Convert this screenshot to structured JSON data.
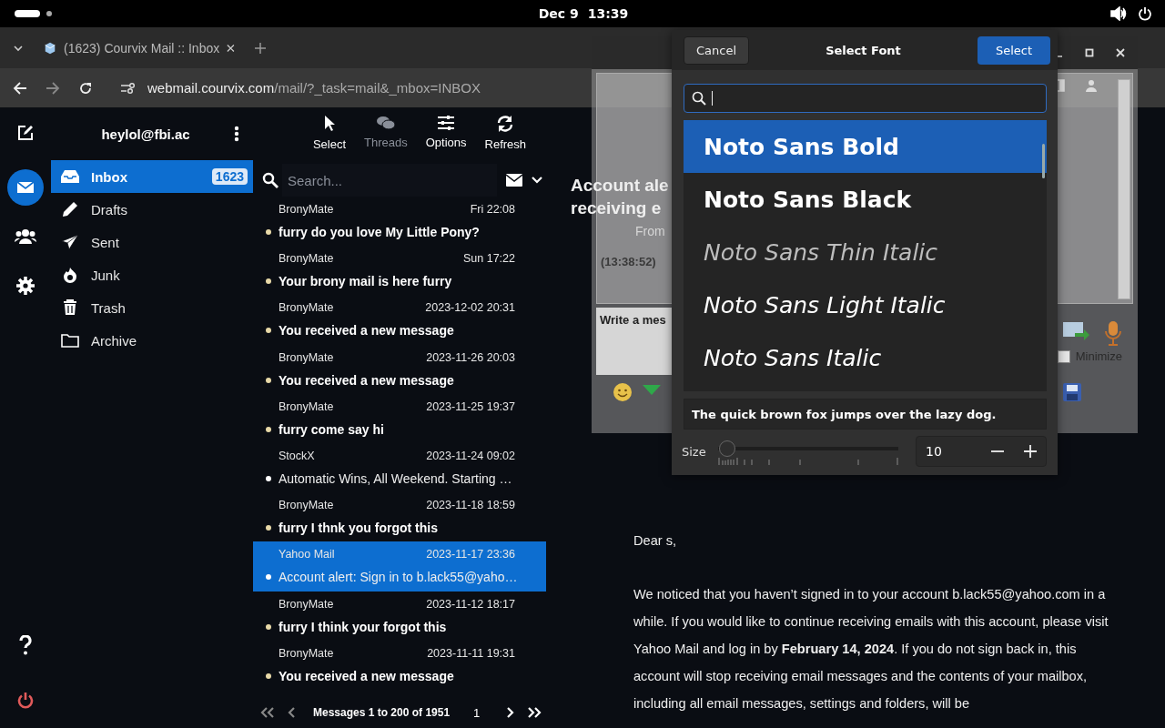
{
  "system_bar": {
    "date": "Dec 9",
    "time": "13:39"
  },
  "browser": {
    "tab_title": "(1623) Courvix Mail :: Inbox",
    "url_host": "webmail.courvix.com",
    "url_path": "/mail/?_task=mail&_mbox=INBOX"
  },
  "rail": [
    {
      "selected": true
    },
    {
      "selected": false
    },
    {
      "selected": false
    }
  ],
  "account": "heylol@fbi.ac",
  "folders": [
    {
      "name": "Inbox",
      "count": "1623",
      "selected": true
    },
    {
      "name": "Drafts",
      "selected": false
    },
    {
      "name": "Sent",
      "selected": false
    },
    {
      "name": "Junk",
      "selected": false
    },
    {
      "name": "Trash",
      "selected": false
    },
    {
      "name": "Archive",
      "selected": false
    }
  ],
  "toolbar": [
    {
      "label": "Select",
      "disabled": false
    },
    {
      "label": "Threads",
      "disabled": true
    },
    {
      "label": "Options",
      "disabled": false
    },
    {
      "label": "Refresh",
      "disabled": false
    }
  ],
  "search": {
    "placeholder": "Search..."
  },
  "messages": [
    {
      "from": "BronyMate",
      "date": "Fri 22:08",
      "subject": "furry do you love My Little Pony?",
      "unread": true,
      "selected": false
    },
    {
      "from": "BronyMate",
      "date": "Sun 17:22",
      "subject": "Your brony mail is here furry",
      "unread": true,
      "selected": false
    },
    {
      "from": "BronyMate",
      "date": "2023-12-02 20:31",
      "subject": "You received a new message",
      "unread": true,
      "selected": false
    },
    {
      "from": "BronyMate",
      "date": "2023-11-26 20:03",
      "subject": "You received a new message",
      "unread": true,
      "selected": false
    },
    {
      "from": "BronyMate",
      "date": "2023-11-25 19:37",
      "subject": "furry come say hi",
      "unread": true,
      "selected": false
    },
    {
      "from": "StockX",
      "date": "2023-11-24 09:02",
      "subject": "Automatic Wins, All Weekend. Starting …",
      "unread": false,
      "selected": false
    },
    {
      "from": "BronyMate",
      "date": "2023-11-18 18:59",
      "subject": "furry I thnk you forgot this",
      "unread": true,
      "selected": false
    },
    {
      "from": "Yahoo Mail",
      "date": "2023-11-17 23:36",
      "subject": "Account alert: Sign in to b.lack55@yaho…",
      "unread": false,
      "selected": true
    },
    {
      "from": "BronyMate",
      "date": "2023-11-12 18:17",
      "subject": "furry I think your forgot this",
      "unread": true,
      "selected": false
    },
    {
      "from": "BronyMate",
      "date": "2023-11-11 19:31",
      "subject": "You received a new message",
      "unread": true,
      "selected": false
    }
  ],
  "pager": {
    "summary": "Messages 1 to 200 of 1951",
    "page": "1"
  },
  "message": {
    "heading_lines": [
      "Account ale",
      "receiving e"
    ],
    "greeting": "Dear s,",
    "body": "We noticed that you haven’t signed in to your account b.lack55@yahoo.com in a while. If you would like to continue receiving emails with this account, please visit Yahoo Mail and log in by **February 14, 2024**. If you do not sign back in, this account will stop receiving email messages and the contents of your mailbox, including all email messages, settings and folders, will be"
  },
  "chat_window": {
    "from_label": "From",
    "timestamp": "(13:38:52)",
    "input_text": "Write a mes",
    "minimize": {
      "label": "Minimize",
      "checked": false
    }
  },
  "font_dialog": {
    "title": "Select Font",
    "cancel": "Cancel",
    "confirm": "Select",
    "fonts": [
      {
        "name": "Noto Sans Bold",
        "kind": "bold",
        "selected": true
      },
      {
        "name": "Noto Sans Black",
        "kind": "black",
        "selected": false
      },
      {
        "name": "Noto Sans Thin Italic",
        "kind": "thinitalic",
        "selected": false
      },
      {
        "name": "Noto Sans Light Italic",
        "kind": "lightitalic",
        "selected": false
      },
      {
        "name": "Noto Sans Italic",
        "kind": "italic",
        "selected": false
      }
    ],
    "preview": "The quick brown fox jumps over the lazy dog.",
    "size": {
      "label": "Size",
      "level": 0.03,
      "value": "10"
    }
  }
}
